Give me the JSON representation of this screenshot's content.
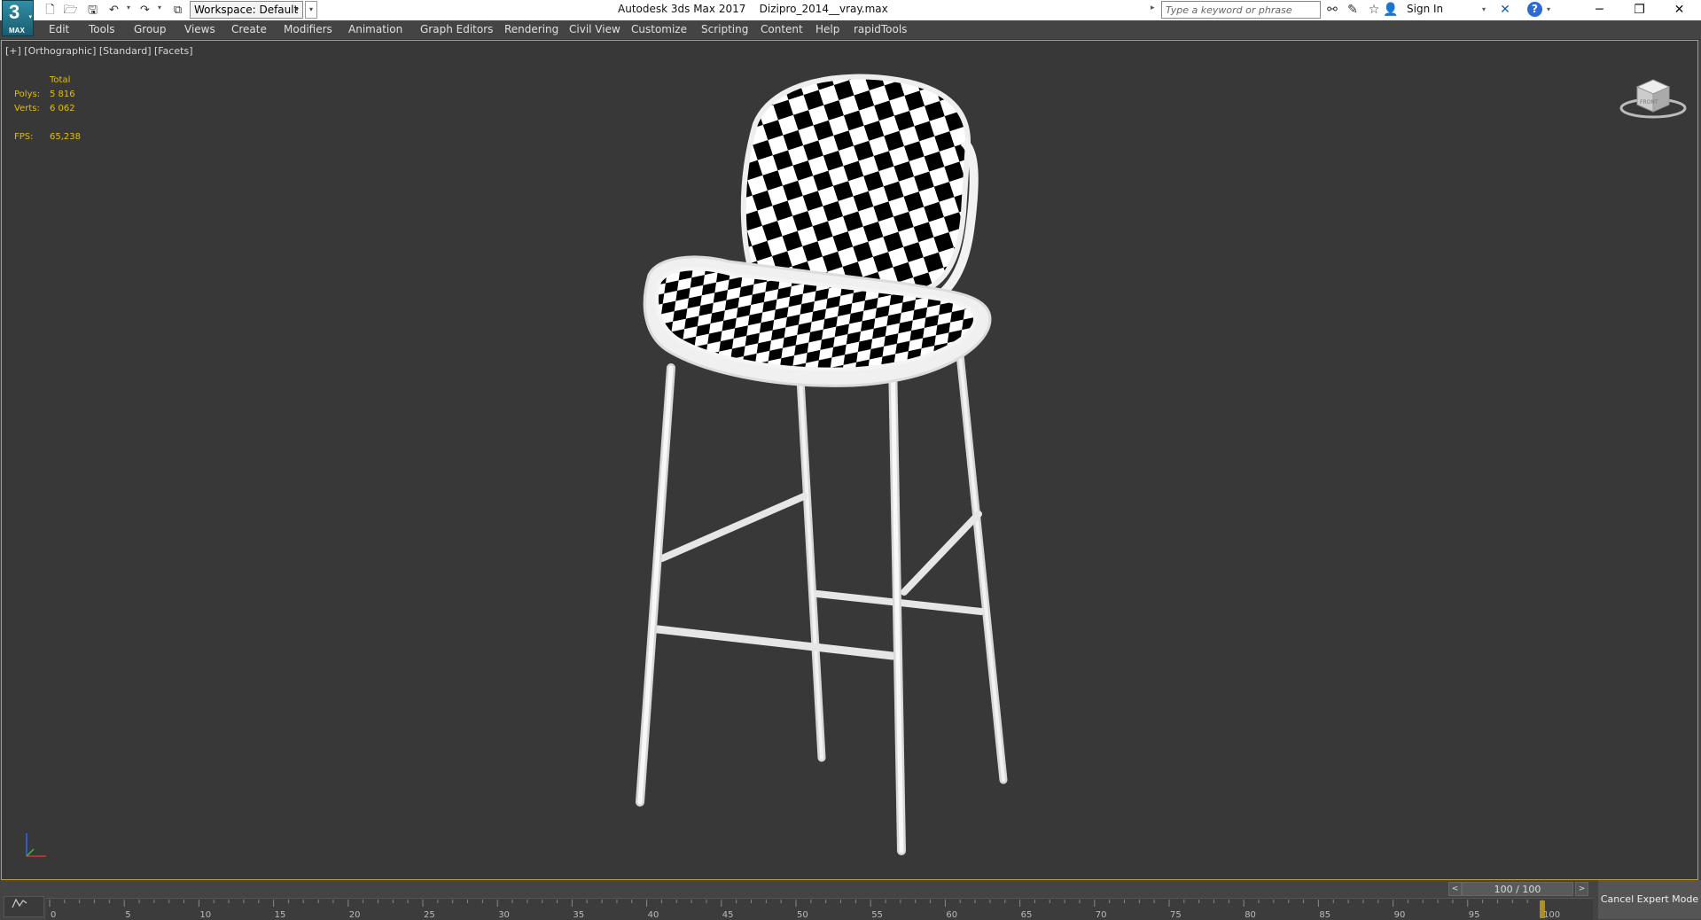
{
  "app": {
    "logo_number": "3",
    "logo_text": "MAX",
    "title": "Autodesk 3ds Max 2017    Dizipro_2014__vray.max",
    "workspace_label": "Workspace: Default"
  },
  "search": {
    "placeholder": "Type a keyword or phrase"
  },
  "account": {
    "sign_in_label": "Sign In"
  },
  "menu": {
    "items": [
      "Edit",
      "Tools",
      "Group",
      "Views",
      "Create",
      "Modifiers",
      "Animation",
      "Graph Editors",
      "Rendering",
      "Civil View",
      "Customize",
      "Scripting",
      "Content",
      "Help",
      "rapidTools"
    ]
  },
  "viewport": {
    "label": "[+] [Orthographic] [Standard] [Facets]",
    "stats": {
      "header": "Total",
      "polys_label": "Polys:",
      "polys_value": "5 816",
      "verts_label": "Verts:",
      "verts_value": "6 062",
      "fps_label": "FPS:",
      "fps_value": "65,238"
    },
    "viewcube_face": "FRONT",
    "accent_color": "#c8a020"
  },
  "timeline": {
    "frame_counter": "100 / 100",
    "prev_label": "<",
    "next_label": ">",
    "ticks": [
      "0",
      "5",
      "10",
      "15",
      "20",
      "25",
      "30",
      "35",
      "40",
      "45",
      "50",
      "55",
      "60",
      "65",
      "70",
      "75",
      "80",
      "85",
      "90",
      "95",
      "100"
    ],
    "current_frame": 100,
    "total_frames": 100
  },
  "statusbar": {
    "cancel_expert_label": "Cancel Expert Mode"
  },
  "colors": {
    "stat_text": "#e0c000",
    "viewport_bg": "#383838",
    "ui_bg": "#444444"
  },
  "icons": {
    "new": "new-file-icon",
    "open": "open-file-icon",
    "save": "save-icon",
    "undo": "undo-icon",
    "redo": "redo-icon",
    "project": "project-folder-icon",
    "binoculars": "binoculars-icon",
    "tools": "tools-icon",
    "favorites": "star-icon",
    "user": "user-icon",
    "exchange": "autodesk-exchange-icon",
    "help": "help-icon"
  }
}
